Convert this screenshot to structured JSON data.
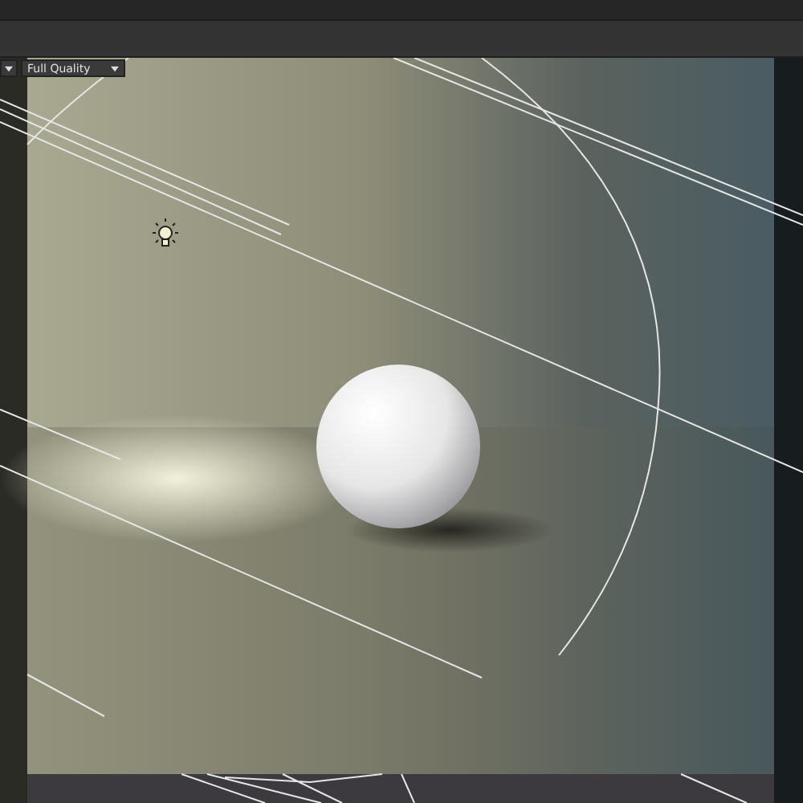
{
  "viewport_toolbar": {
    "quality_dropdown": {
      "value": "Full Quality"
    }
  }
}
